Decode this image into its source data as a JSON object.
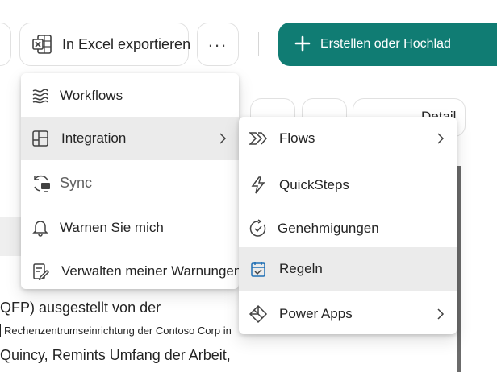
{
  "toolbar": {
    "export_label": "In Excel exportieren",
    "more_label": "...",
    "create_label": "Erstellen oder Hochlad",
    "create_icon": "plus-icon",
    "export_icon": "excel-icon",
    "accent_color": "#107c73"
  },
  "background": {
    "chip_label": "Detail",
    "document_lines": [
      "QFP) ausgestellt von der",
      "Rechenzentrumseinrichtung der Contoso Corp in",
      "Quincy, Remints Umfang der Arbeit,",
      "..."
    ]
  },
  "main_menu": {
    "items": [
      {
        "label": "Workflows",
        "icon": "workflows-icon"
      },
      {
        "label": "Integration",
        "icon": "integration-icon",
        "has_submenu": true,
        "highlighted": true
      },
      {
        "label": "Sync",
        "icon": "sync-icon"
      },
      {
        "label": "Warnen Sie mich",
        "icon": "bell-icon"
      },
      {
        "label": "Verwalten meiner Warnungen",
        "icon": "manage-alerts-icon"
      }
    ]
  },
  "sub_menu": {
    "items": [
      {
        "label": "Flows",
        "icon": "flows-icon",
        "has_submenu": true
      },
      {
        "label": "QuickSteps",
        "icon": "quicksteps-icon"
      },
      {
        "label": "Genehmigungen",
        "icon": "approvals-icon"
      },
      {
        "label": "Regeln",
        "icon": "rules-icon",
        "highlighted": true
      },
      {
        "label": "Power Apps",
        "icon": "power-apps-icon",
        "has_submenu": true
      }
    ]
  }
}
